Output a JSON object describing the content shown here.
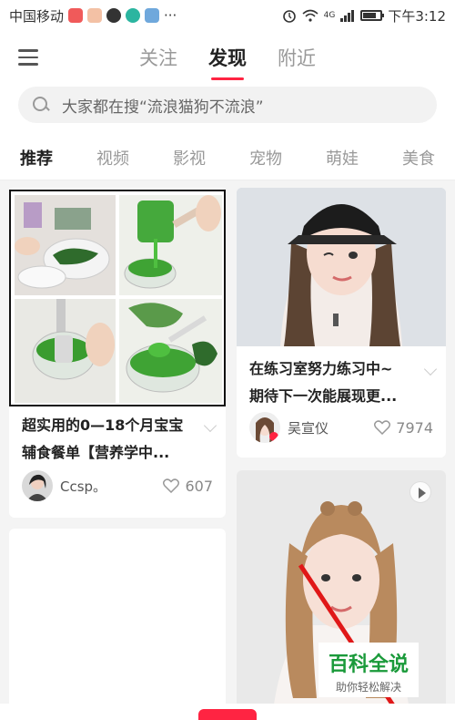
{
  "status_bar": {
    "carrier": "中国移动",
    "dots": "···",
    "signal": "4G",
    "time": "下午3:12"
  },
  "header": {
    "tabs": [
      {
        "label": "关注",
        "active": false
      },
      {
        "label": "发现",
        "active": true
      },
      {
        "label": "附近",
        "active": false
      }
    ]
  },
  "search": {
    "placeholder": "大家都在搜“流浪猫狗不流浪”"
  },
  "categories": [
    {
      "label": "推荐",
      "active": true
    },
    {
      "label": "视频",
      "active": false
    },
    {
      "label": "影视",
      "active": false
    },
    {
      "label": "宠物",
      "active": false
    },
    {
      "label": "萌娃",
      "active": false
    },
    {
      "label": "美食",
      "active": false
    }
  ],
  "feed": {
    "left": [
      {
        "title_line1": "超实用的0—18个月宝宝",
        "title_line2": "辅食餐单【营养学中...",
        "author": "Ccsp。",
        "likes": "607"
      },
      {
        "title_line1": "",
        "author": "",
        "likes": ""
      }
    ],
    "right": [
      {
        "title_line1": "在练习室努力练习中~",
        "title_line2": "期待下一次能展现更...",
        "author": "吴宣仪",
        "likes": "7974"
      },
      {
        "is_video": true
      }
    ]
  },
  "watermark": {
    "title": "百科全说",
    "subtitle": "助你轻松解决"
  },
  "colors": {
    "accent": "#ff2442",
    "watermark_green": "#1a9a3a"
  }
}
